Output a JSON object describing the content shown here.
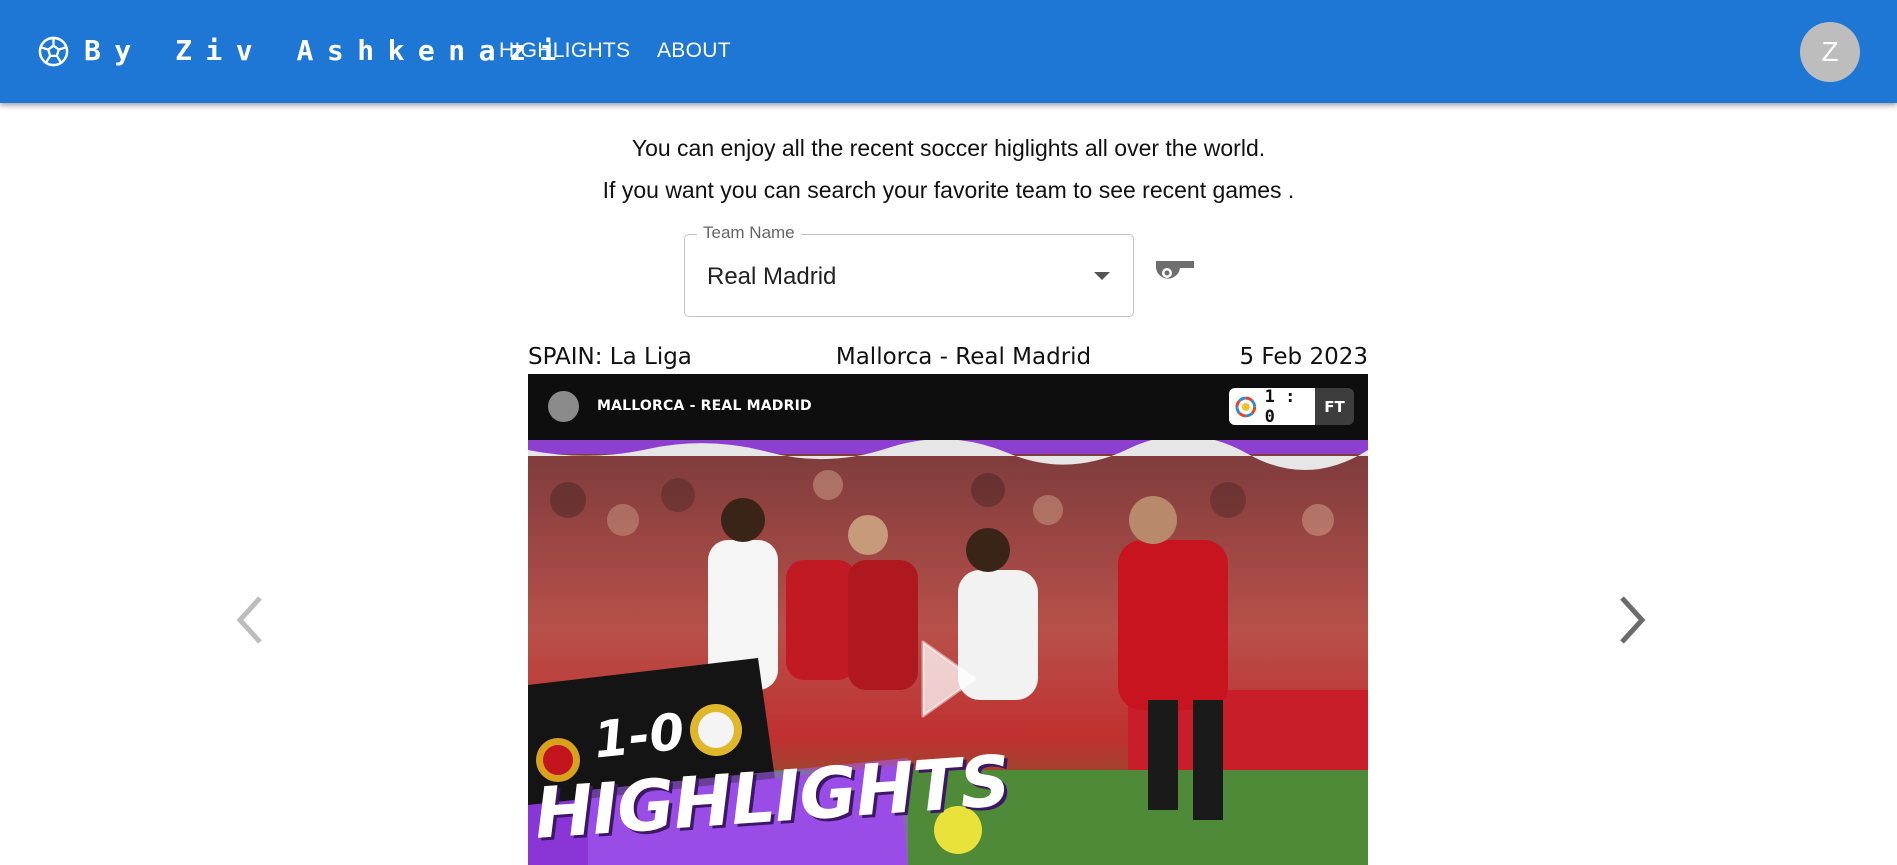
{
  "header": {
    "brand": "By Ziv Ashkenazi",
    "logo_icon": "soccer-ball-icon",
    "nav": [
      {
        "label": "HIGHLIGHTS"
      },
      {
        "label": "ABOUT"
      }
    ],
    "avatar_initial": "Z",
    "bar_color": "#1e76d5"
  },
  "intro": {
    "line1": "You can enjoy all the recent soccer higlights all over the world.",
    "line2": "If you want you can search your favorite team to see recent games ."
  },
  "search": {
    "label": "Team Name",
    "value": "Real Madrid",
    "dropdown_icon": "arrow-drop-down-icon",
    "action_icon": "whistle-icon"
  },
  "game": {
    "league": "SPAIN: La Liga",
    "match": "Mallorca - Real Madrid",
    "date": "5 Feb 2023",
    "video": {
      "title": "MALLORCA - REAL MADRID",
      "score": "1 : 0",
      "status": "FT",
      "thumbnail_score": "1-0",
      "thumbnail_caption": "HIGHLIGHTS",
      "play_icon": "play-icon"
    }
  },
  "carousel": {
    "prev_icon": "chevron-left-icon",
    "next_icon": "chevron-right-icon"
  }
}
